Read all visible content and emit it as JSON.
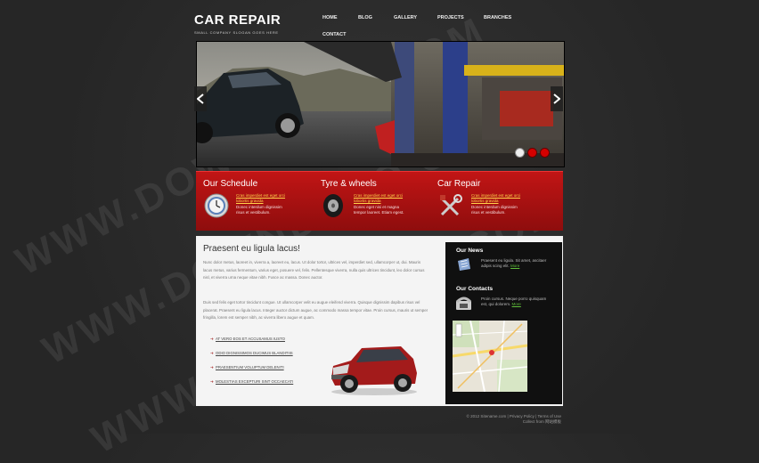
{
  "header": {
    "logo": "CAR REPAIR",
    "slogan": "SMALL COMPANY SLOGAN GOES HERE",
    "nav": [
      "HOME",
      "BLOG",
      "GALLERY",
      "PROJECTS",
      "BRANCHES",
      "CONTACT"
    ]
  },
  "slider": {
    "slide_count": 3,
    "active_index": 0
  },
  "features": [
    {
      "title": "Our Schedule",
      "link": "Cras imperdiet est eget orci lobortis gravida",
      "text": "Donec interdum dignissim risus et vestibulum.",
      "icon": "clock-icon"
    },
    {
      "title": "Tyre & wheels",
      "link": "Cras imperdiet est eget orci lobortis gravida",
      "text": "Donec eget nisi et magna tempor laoreet. Etiam egest.",
      "icon": "tyre-icon"
    },
    {
      "title": "Car Repair",
      "link": "Cras imperdiet est eget orci lobortis gravida",
      "text": "Donec interdum dignissim risus et vestibulum.",
      "icon": "tools-icon"
    }
  ],
  "main": {
    "title": "Praesent eu ligula lacus!",
    "paragraph1": "Nunc dolor metus, laoreet in, viverra a, laoreet eu, lacus. Ut dolor tortor, ultrices vel, imperdiet sed, ullamcorper ut, dui. Mauris lacus metus, varius fermentum, varius eget, posuere vel, felis. Pellentesque viverra, nulla quis ultrices tincidunt, leo dolor cursus nisl, et viverra urna neque vitae nibh. Fusce ac massa. Donec auctor.",
    "paragraph2": "Duis sed felis eget tortor tincidunt congue. Ut ullamcorper velit eu augue eleifend viverra. Quisque dignissim dapibus risus vel placerat. Praesent eu ligula lacus. Integer auctor dictum augue, ac commodo massa tempor vitae. Proin cursus, mauris ut semper fringilla, lorem est semper nibh, ac viverra libero augue et quam.",
    "list": [
      "At vero eos et accusamus iusto",
      "Odio dignissimos ducimus blanditiis",
      "Praesentium voluptum deleniti",
      "Molestias excepturi sint occaecati"
    ]
  },
  "sidebar": {
    "news_title": "Our News",
    "news_text": "Praesent eu ligula. Sit amet, ascitaer adipis scing elit.",
    "news_more": "More",
    "contacts_title": "Our Contacts",
    "contacts_text": "Proin cursus. Neque porro quisquam est, qui dolorem.",
    "contacts_more": "More"
  },
  "footer": {
    "copyright": "© 2012 Sitename.com",
    "privacy": "Privacy Policy",
    "terms": "Terms of Use",
    "collect": "Collect from 网站模板"
  },
  "watermark": "WWW.DOWNDEMO.COM",
  "colors": {
    "accent_red": "#b11212",
    "link_yellow": "#ffd24a",
    "more_green": "#5fbf3a"
  }
}
